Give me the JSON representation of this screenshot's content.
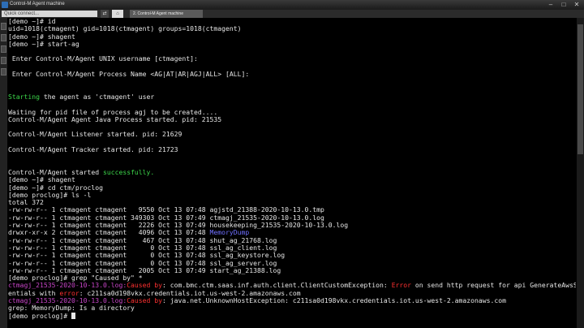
{
  "window": {
    "title": "Control-M Agent machine"
  },
  "tabbar": {
    "quick_connect_placeholder": "Quick connect...",
    "home_label": "⌂",
    "tab_label": "2. Control-M Agent machine"
  },
  "terminal": {
    "lines": [
      [
        {
          "t": "[demo ~]# id"
        }
      ],
      [
        {
          "t": "uid=1018(ctmagent) gid=1018(ctmagent) groups=1018(ctmagent)"
        }
      ],
      [
        {
          "t": "[demo ~]# shagent"
        }
      ],
      [
        {
          "t": "[demo ~]# start-ag"
        }
      ],
      [
        {
          "t": ""
        }
      ],
      [
        {
          "t": " Enter Control-M/Agent UNIX username [ctmagent]:"
        }
      ],
      [
        {
          "t": ""
        }
      ],
      [
        {
          "t": " Enter Control-M/Agent Process Name <AG|AT|AR|AGJ|ALL> [ALL]:"
        }
      ],
      [
        {
          "t": ""
        }
      ],
      [
        {
          "t": ""
        }
      ],
      [
        {
          "t": "Starting",
          "c": "green"
        },
        {
          "t": " the agent as 'ctmagent' user"
        }
      ],
      [
        {
          "t": ""
        }
      ],
      [
        {
          "t": "Waiting for pid file of process agj to be created...."
        }
      ],
      [
        {
          "t": "Control-M/Agent Agent Java Process started. pid: 21535"
        }
      ],
      [
        {
          "t": ""
        }
      ],
      [
        {
          "t": "Control-M/Agent Listener started. pid: 21629"
        }
      ],
      [
        {
          "t": ""
        }
      ],
      [
        {
          "t": "Control-M/Agent Tracker started. pid: 21723"
        }
      ],
      [
        {
          "t": ""
        }
      ],
      [
        {
          "t": ""
        }
      ],
      [
        {
          "t": "Control-M/Agent started "
        },
        {
          "t": "successfully.",
          "c": "green"
        }
      ],
      [
        {
          "t": "[demo ~]# shagent"
        }
      ],
      [
        {
          "t": "[demo ~]# cd ctm/proclog"
        }
      ],
      [
        {
          "t": "[demo proclog]# ls -l"
        }
      ],
      [
        {
          "t": "total 372"
        }
      ],
      [
        {
          "t": "-rw-rw-r-- 1 ctmagent ctmagent   9550 Oct 13 07:48 agjstd_21388-2020-10-13.0.tmp"
        }
      ],
      [
        {
          "t": "-rw-rw-r-- 1 ctmagent ctmagent 349303 Oct 13 07:49 ctmagj_21535-2020-10-13.0.log"
        }
      ],
      [
        {
          "t": "-rw-rw-r-- 1 ctmagent ctmagent   2226 Oct 13 07:49 housekeeping_21535-2020-10-13.0.log"
        }
      ],
      [
        {
          "t": "drwxr-xr-x 2 ctmagent ctmagent   4096 Oct 13 07:48 "
        },
        {
          "t": "MemoryDump",
          "c": "blue"
        }
      ],
      [
        {
          "t": "-rw-rw-r-- 1 ctmagent ctmagent    467 Oct 13 07:48 shut_ag_21768.log"
        }
      ],
      [
        {
          "t": "-rw-rw-r-- 1 ctmagent ctmagent      0 Oct 13 07:48 ssl_ag_client.log"
        }
      ],
      [
        {
          "t": "-rw-rw-r-- 1 ctmagent ctmagent      0 Oct 13 07:48 ssl_ag_keystore.log"
        }
      ],
      [
        {
          "t": "-rw-rw-r-- 1 ctmagent ctmagent      0 Oct 13 07:48 ssl_ag_server.log"
        }
      ],
      [
        {
          "t": "-rw-rw-r-- 1 ctmagent ctmagent   2005 Oct 13 07:49 start_ag_21388.log"
        }
      ],
      [
        {
          "t": "[demo proclog]# grep \"Caused by\" *"
        }
      ],
      [
        {
          "t": "ctmagj_21535-2020-10-13.0.log:",
          "c": "magenta"
        },
        {
          "t": "Caused by",
          "c": "red"
        },
        {
          "t": ": com.bmc.ctm.saas.inf.auth.client.ClientCustomException: "
        },
        {
          "t": "Error",
          "c": "red"
        },
        {
          "t": " on send http request for api GenerateAwsSessionCred"
        }
      ],
      [
        {
          "t": "entials with "
        },
        {
          "t": "error",
          "c": "red"
        },
        {
          "t": ": c211sa0d198vkx.credentials.iot.us-west-2.amazonaws.com"
        }
      ],
      [
        {
          "t": "ctmagj_21535-2020-10-13.0.log:",
          "c": "magenta"
        },
        {
          "t": "Caused by",
          "c": "red"
        },
        {
          "t": ": java.net.UnknownHostException: c211sa0d198vkx.credentials.iot.us-west-2.amazonaws.com"
        }
      ],
      [
        {
          "t": "grep: MemoryDump: Is a directory"
        }
      ],
      [
        {
          "t": "[demo proclog]# "
        }
      ]
    ]
  }
}
